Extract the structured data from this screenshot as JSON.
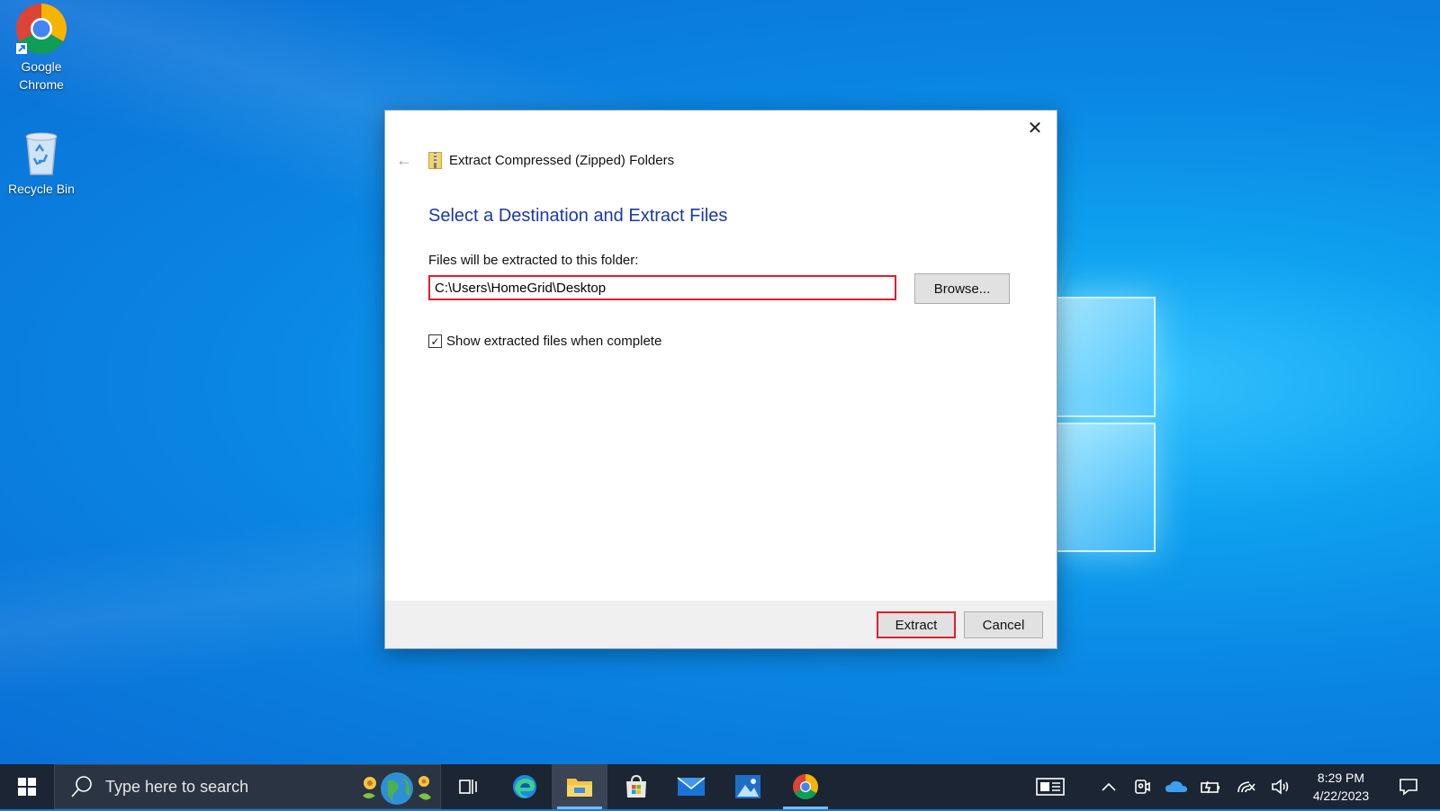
{
  "desktop": {
    "icons": [
      {
        "label": "Google Chrome",
        "icon": "chrome-icon"
      },
      {
        "label": "Recycle Bin",
        "icon": "recycle-bin-icon"
      }
    ]
  },
  "dialog": {
    "title": "Extract Compressed (Zipped) Folders",
    "heading": "Select a Destination and Extract Files",
    "path_label": "Files will be extracted to this folder:",
    "path_value": "C:\\Users\\HomeGrid\\Desktop",
    "browse_label": "Browse...",
    "show_files_label": "Show extracted files when complete",
    "show_files_checked": true,
    "extract_label": "Extract",
    "cancel_label": "Cancel",
    "close_glyph": "✕",
    "back_glyph": "←",
    "highlight_color": "#e0202a",
    "heading_color": "#1a3aa3"
  },
  "taskbar": {
    "search_placeholder": "Type here to search",
    "apps": [
      "task-view-icon",
      "edge-icon",
      "file-explorer-icon",
      "store-icon",
      "mail-icon",
      "photos-icon",
      "chrome-icon"
    ],
    "tray": [
      "news-icon",
      "chevron-up-icon",
      "meet-now-icon",
      "onedrive-icon",
      "battery-icon",
      "wifi-icon",
      "volume-icon"
    ],
    "time": "8:29 PM",
    "date": "4/22/2023",
    "background": "#1b2533"
  }
}
